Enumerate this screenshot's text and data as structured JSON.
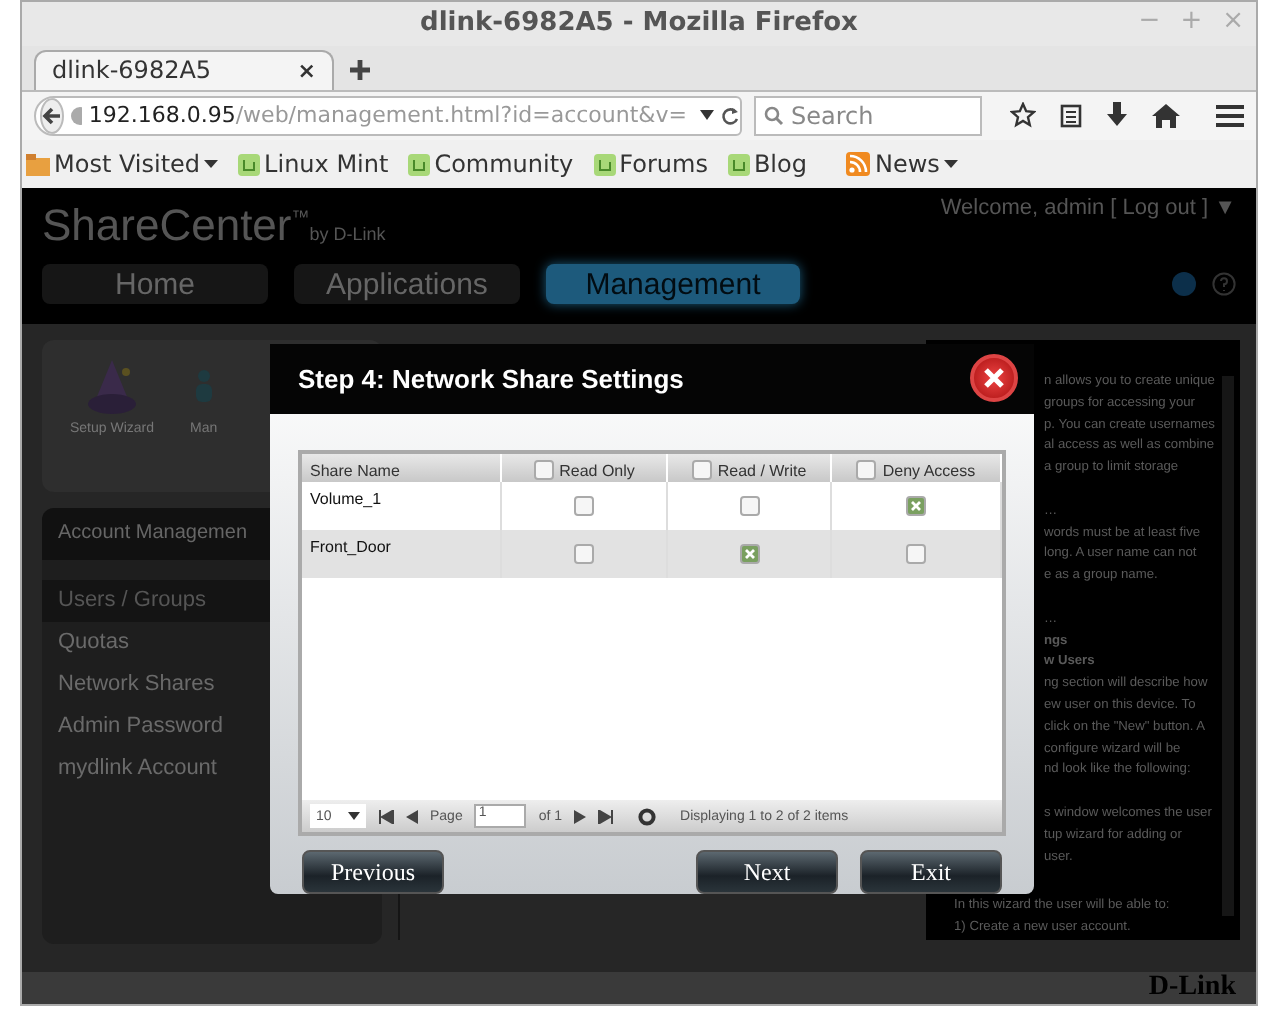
{
  "window": {
    "title": "dlink-6982A5 - Mozilla Firefox",
    "controls": [
      "−",
      "+",
      "×"
    ]
  },
  "tabs": [
    {
      "label": "dlink-6982A5",
      "selected": true,
      "close": "×"
    }
  ],
  "address_bar": {
    "host": "192.168.0.95",
    "path": "/web/management.html?id=account&v="
  },
  "search": {
    "placeholder": "Search"
  },
  "bookmarks": [
    {
      "label": "Most Visited",
      "kind": "folder",
      "dropdown": true
    },
    {
      "label": "Linux Mint",
      "kind": "mint",
      "dropdown": false
    },
    {
      "label": "Community",
      "kind": "mint",
      "dropdown": false
    },
    {
      "label": "Forums",
      "kind": "mint",
      "dropdown": false
    },
    {
      "label": "Blog",
      "kind": "mint",
      "dropdown": false
    },
    {
      "label": "News",
      "kind": "rss",
      "dropdown": true
    }
  ],
  "app": {
    "logo": {
      "name": "ShareCenter",
      "tm": "™",
      "by": "by D-Link"
    },
    "welcome": "Welcome, admin [ Log out ] ▼",
    "nav_tabs": [
      {
        "label": "Home",
        "selected": false
      },
      {
        "label": "Applications",
        "selected": false
      },
      {
        "label": "Management",
        "selected": true
      }
    ],
    "shortcuts": [
      {
        "label": "Setup Wizard"
      },
      {
        "label": "Man"
      }
    ],
    "sidebar": {
      "title": "Account Managemen",
      "items": [
        {
          "label": "Users / Groups",
          "selected": true
        },
        {
          "label": "Quotas",
          "selected": false
        },
        {
          "label": "Network Shares",
          "selected": false
        },
        {
          "label": "Admin Password",
          "selected": false
        },
        {
          "label": "mydlink Account",
          "selected": false
        }
      ]
    },
    "help": {
      "clipped_paragraphs": [
        [
          "n allows you to create unique",
          "groups for accessing your",
          "p. You can create usernames",
          "al access as well as combine",
          "a group to limit storage"
        ],
        [
          "…",
          "words must be at least five",
          "long. A user name can not",
          "e as a group name."
        ],
        [
          "…",
          "**ngs**",
          "**w Users**",
          "ng section will describe how",
          "ew user on this device. To",
          "click on the \"New\" button. A",
          "configure wizard will be",
          "nd look like the following:"
        ],
        [
          "s window welcomes the user",
          "tup wizard for adding or",
          "user."
        ]
      ],
      "lines": [
        "In this wizard the user will be able to:",
        "1) Create a new user account."
      ]
    },
    "footer_logo": "D-Link"
  },
  "dialog": {
    "title": "Step 4: Network Share Settings",
    "columns": [
      {
        "label": "Share Name",
        "kind": "text"
      },
      {
        "label": "Read Only",
        "kind": "checkbox",
        "checked": false
      },
      {
        "label": "Read / Write",
        "kind": "checkbox",
        "checked": false
      },
      {
        "label": "Deny Access",
        "kind": "checkbox",
        "checked": false
      }
    ],
    "rows": [
      {
        "name": "Volume_1",
        "access": [
          false,
          false,
          true
        ]
      },
      {
        "name": "Front_Door",
        "access": [
          false,
          true,
          false
        ]
      }
    ],
    "pager": {
      "page_size": "10",
      "page_label": "Page",
      "page": "1",
      "of": "of 1",
      "status": "Displaying 1 to 2 of 2 items"
    },
    "buttons": [
      "Previous",
      "Next",
      "Exit"
    ]
  }
}
